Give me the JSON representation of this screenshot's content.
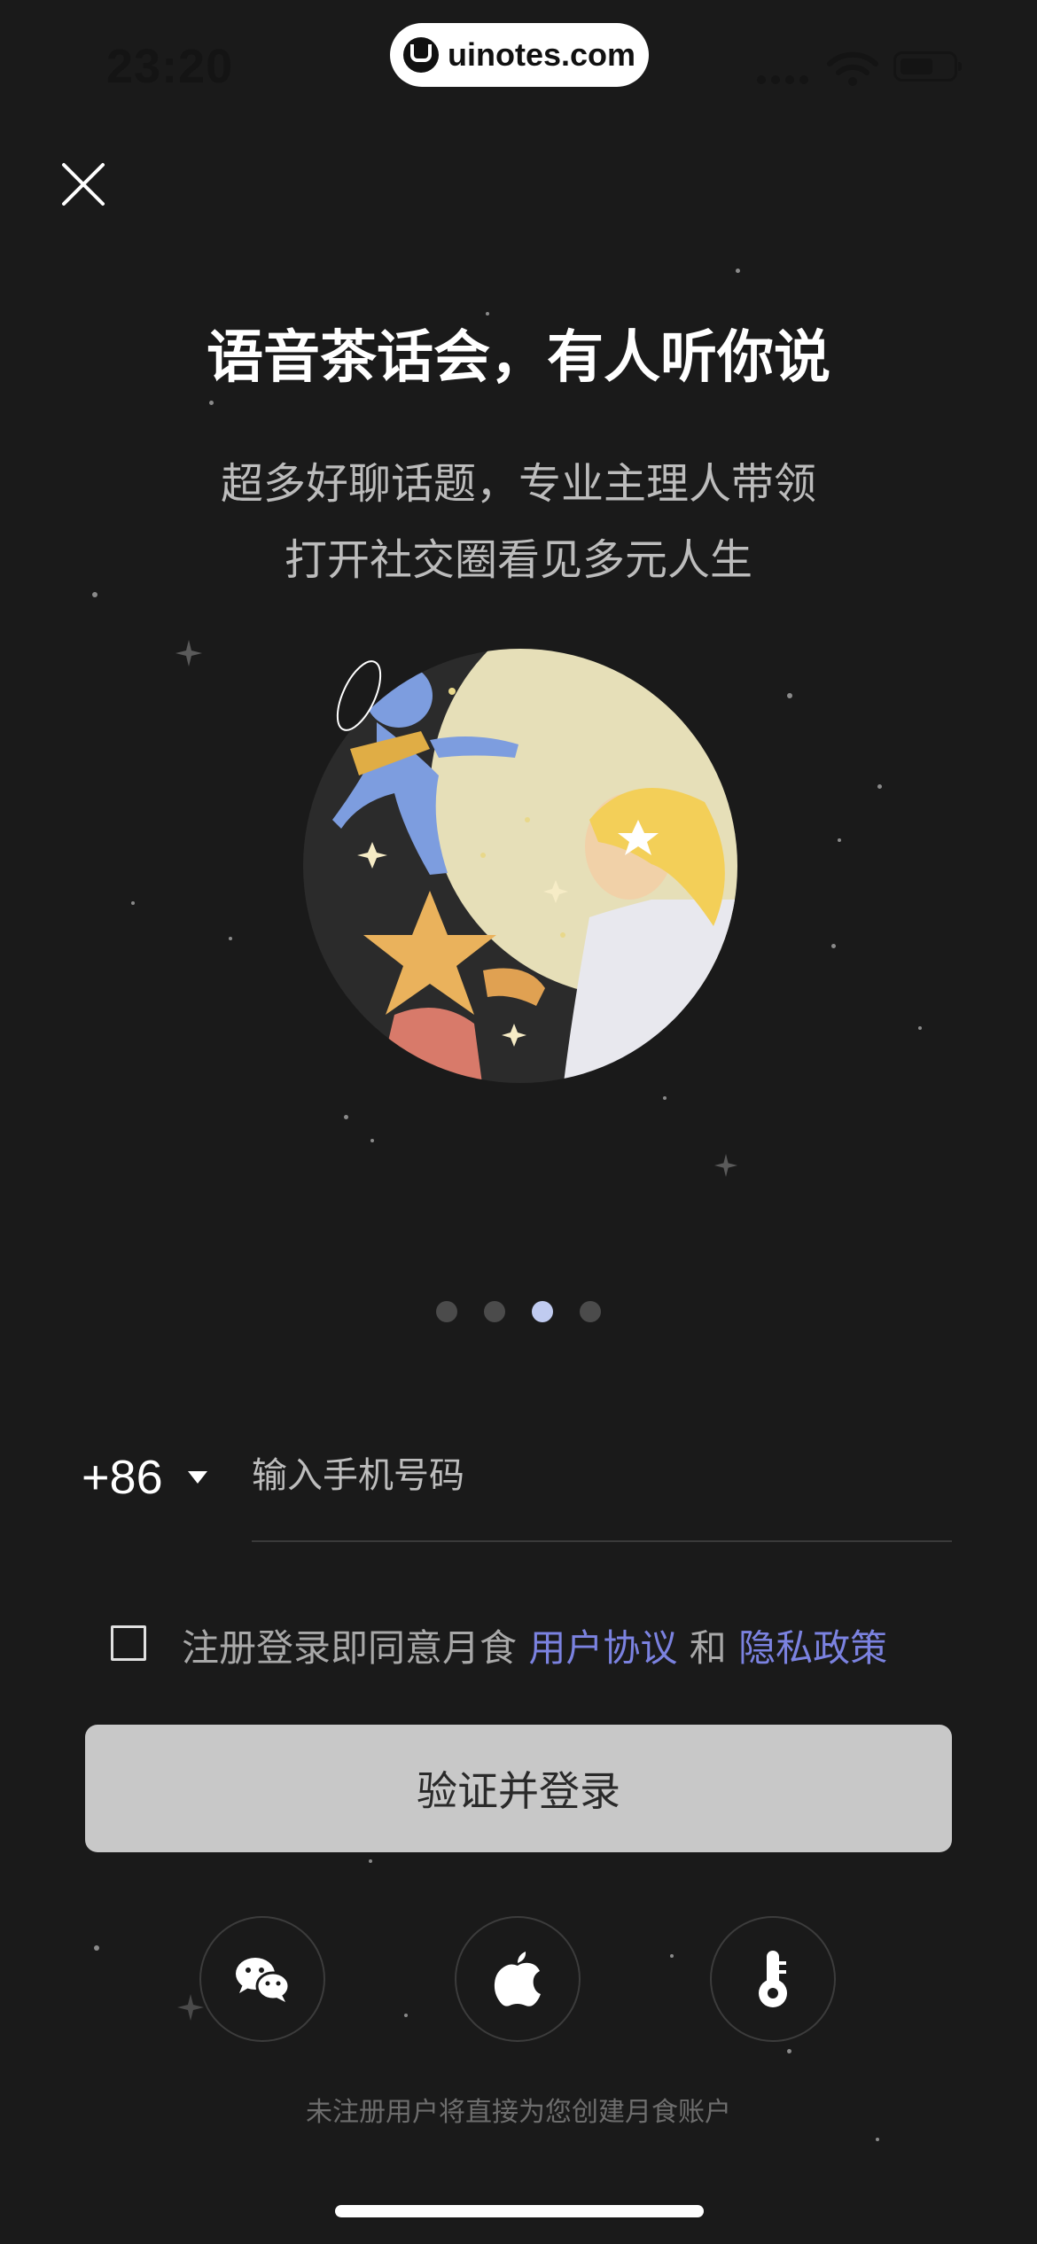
{
  "status_bar": {
    "time": "23:20",
    "watermark": "uinotes.com"
  },
  "intro": {
    "headline": "语音茶话会，有人听你说",
    "subline_1": "超多好聊话题，专业主理人带领",
    "subline_2": "打开社交圈看见多元人生"
  },
  "pager": {
    "count": 4,
    "active_index": 2
  },
  "login_form": {
    "country_code": "+86",
    "phone_placeholder": "输入手机号码",
    "agreement_prefix": "注册登录即同意月食 ",
    "agreement_user_link": "用户协议",
    "agreement_and": " 和 ",
    "agreement_privacy_link": "隐私政策",
    "submit_label": "验证并登录"
  },
  "social_login": {
    "icons": [
      "wechat-icon",
      "apple-icon",
      "thermometer-icon"
    ]
  },
  "footer_note": "未注册用户将直接为您创建月食账户",
  "colors": {
    "background": "#1a1a1a",
    "link": "#7b82e0",
    "active_dot": "#c0cbf0",
    "button": "#c8c8c8"
  }
}
